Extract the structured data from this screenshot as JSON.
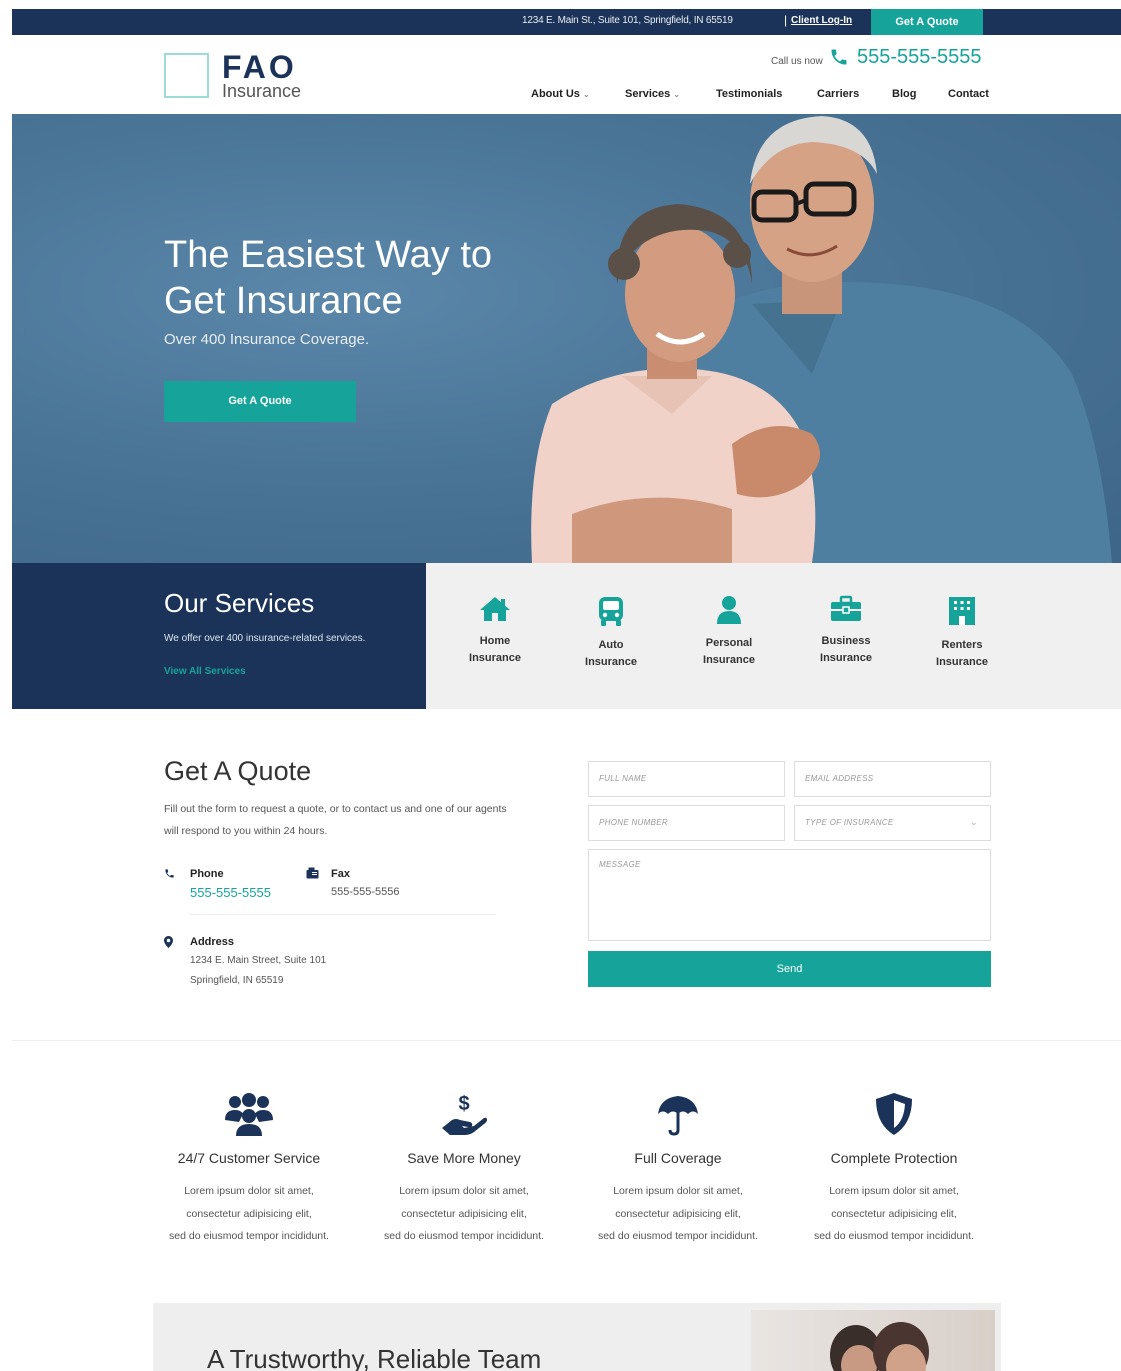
{
  "topbar": {
    "address": "1234 E. Main St., Suite 101, Springfield, IN 65519",
    "separator": "|",
    "client_login": "Client Log-In",
    "get_quote": "Get A Quote"
  },
  "header": {
    "logo_main": "FAO",
    "logo_sub": "Insurance",
    "call_label": "Call us now",
    "phone": "555-555-5555",
    "nav": [
      "About Us",
      "Services",
      "Testimonials",
      "Carriers",
      "Blog",
      "Contact"
    ]
  },
  "hero": {
    "title_line1": "The Easiest Way to",
    "title_line2": "Get Insurance",
    "subtitle": "Over 400 Insurance Coverage.",
    "button": "Get A Quote"
  },
  "services": {
    "title": "Our Services",
    "description": "We offer over 400 insurance-related services.",
    "link": "View All Services",
    "items": [
      {
        "icon": "house-icon",
        "line1": "Home",
        "line2": "Insurance"
      },
      {
        "icon": "car-icon",
        "line1": "Auto",
        "line2": "Insurance"
      },
      {
        "icon": "person-icon",
        "line1": "Personal",
        "line2": "Insurance"
      },
      {
        "icon": "briefcase-icon",
        "line1": "Business",
        "line2": "Insurance"
      },
      {
        "icon": "building-icon",
        "line1": "Renters",
        "line2": "Insurance"
      }
    ]
  },
  "quote": {
    "title": "Get A Quote",
    "description": "Fill out the form to request a quote, or to contact us and one of our agents will respond to you within 24 hours.",
    "phone_label": "Phone",
    "phone_value": "555-555-5555",
    "fax_label": "Fax",
    "fax_value": "555-555-5556",
    "address_label": "Address",
    "address_line1": "1234 E. Main Street, Suite 101",
    "address_line2": "Springfield, IN 65519",
    "form": {
      "full_name": "FULL NAME",
      "email": "EMAIL ADDRESS",
      "phone": "PHONE NUMBER",
      "type": "TYPE OF INSURANCE",
      "message": "MESSAGE",
      "send": "Send"
    }
  },
  "features": [
    {
      "icon": "people-group-icon",
      "title": "24/7 Customer Service",
      "l1": "Lorem ipsum dolor sit amet,",
      "l2": "consectetur adipisicing elit,",
      "l3": "sed do eiusmod tempor incididunt."
    },
    {
      "icon": "money-hand-icon",
      "title": "Save More Money",
      "l1": "Lorem ipsum dolor sit amet,",
      "l2": "consectetur adipisicing elit,",
      "l3": "sed do eiusmod tempor incididunt."
    },
    {
      "icon": "umbrella-icon",
      "title": "Full Coverage",
      "l1": "Lorem ipsum dolor sit amet,",
      "l2": "consectetur adipisicing elit,",
      "l3": "sed do eiusmod tempor incididunt."
    },
    {
      "icon": "shield-icon",
      "title": "Complete Protection",
      "l1": "Lorem ipsum dolor sit amet,",
      "l2": "consectetur adipisicing elit,",
      "l3": "sed do eiusmod tempor incididunt."
    }
  ],
  "trust": {
    "title": "A Trustworthy, Reliable Team"
  },
  "colors": {
    "navy": "#1b3358",
    "teal": "#16a49a",
    "hero_blue": "#4a7597"
  }
}
